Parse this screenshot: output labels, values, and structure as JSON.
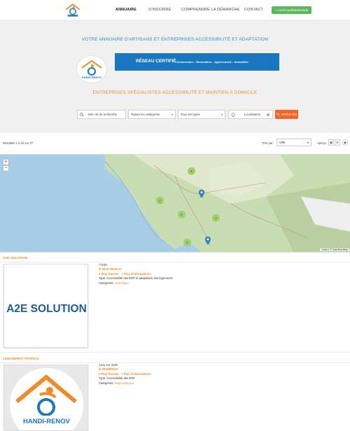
{
  "nav": {
    "items": [
      {
        "label": "ANNUAIRE",
        "active": true
      },
      {
        "label": "S'INSCRIRE"
      },
      {
        "label": "COMPRENDRE LA DÉMARCHE"
      },
      {
        "label": "CONTACT"
      }
    ],
    "pro_button": "+ Accès professionnels"
  },
  "hero": {
    "title": "VOTRE ANNUAIRE D'ARTISANS ET ENTREPRISES ACCESSIBILITÉ ET ADAPTATION",
    "logo_text": "HANDI-RENOV",
    "banner_title": "RÉSEAU CERTIFIÉ",
    "banner_sub": "Construction – Rénovation – Agencement – Immobilier",
    "subtitle": "ENTREPRISES SPÉCIALISTES ACCESSIBILITÉ ET MAINTIEN À DOMICILE"
  },
  "search": {
    "keyword_placeholder": "Mot clé de recherche",
    "categories": "Toutes les catégories",
    "types": "Tous les types",
    "location_placeholder": "Localisation",
    "button": "Recherche"
  },
  "results": {
    "count": "Résultats 1 à 20 sur 37",
    "sort_label": "Trier par:",
    "sort_value": "Ville",
    "view_label": "Aperçu :"
  },
  "map": {
    "zoom_in": "+",
    "zoom_out": "−",
    "attribution": "Leaflet | © OpenStreetMap",
    "clusters": [
      "6",
      "2",
      "2",
      "4",
      "2"
    ]
  },
  "listings": [
    {
      "title": "A2E SOLUTION",
      "image_text": "A2E SOLUTION",
      "postcode": "77100",
      "phone": "06.07.88.49.47",
      "plan": "Plan d'accès",
      "more": "Plus d'informations",
      "type": "Type: Accessibilité des ERP et adaptation des logements",
      "cat_label": "Catégories:",
      "category": "Domotique"
    },
    {
      "title": "LENCREROT PATRICK",
      "image_text": "HANDI-RENOV",
      "postcode": "Auxy sur Juine",
      "phone": "0615983227",
      "plan": "Plan d'accès",
      "more": "Plus d'informations",
      "type": "Type: Accessibilité des ERP",
      "cat_label": "Catégories:",
      "category": "Diagnostiqueur"
    }
  ],
  "colors": {
    "accent_orange": "#f08a2a",
    "brand_blue": "#1a76be",
    "green_button": "#5cb85c",
    "search_orange": "#f26522"
  }
}
